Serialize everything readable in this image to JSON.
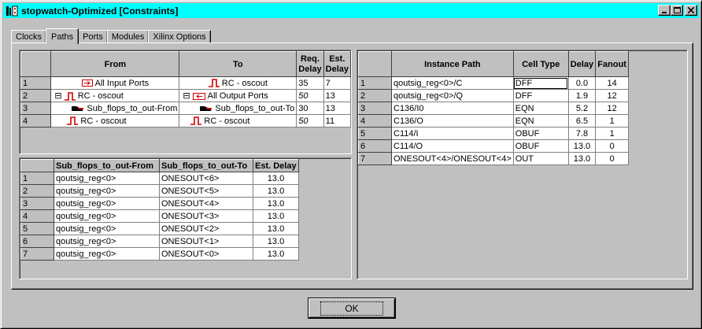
{
  "window": {
    "title": "stopwatch-Optimized [Constraints]",
    "titlebar_color": "#00ffff"
  },
  "tabs": [
    {
      "label": "Clocks",
      "active": false
    },
    {
      "label": "Paths",
      "active": true
    },
    {
      "label": "Ports",
      "active": false
    },
    {
      "label": "Modules",
      "active": false
    },
    {
      "label": "Xilinx Options",
      "active": false
    }
  ],
  "paths_table": {
    "headers": {
      "from": "From",
      "to": "To",
      "req_delay": "Req. Delay",
      "est_delay": "Est. Delay"
    },
    "rows": [
      {
        "num": "1",
        "from_icon": "input-port-icon",
        "from": "All Input Ports",
        "to_icon": "clock-icon",
        "to": "RC - oscout",
        "req": "35",
        "req_italic": false,
        "est": "7"
      },
      {
        "num": "2",
        "from_icon": "clock-icon",
        "from": "RC - oscout",
        "from_expand": "⊟",
        "to_icon": "output-port-icon",
        "to": "All Output Ports",
        "to_expand": "⊟",
        "req": "50",
        "req_italic": true,
        "est": "13"
      },
      {
        "num": "3",
        "from_icon": "subset-icon",
        "from": "Sub_flops_to_out-From",
        "to_icon": "subset-icon",
        "to": "Sub_flops_to_out-To",
        "req": "30",
        "req_italic": false,
        "est": "13"
      },
      {
        "num": "4",
        "from_icon": "clock-icon",
        "from": "RC - oscout",
        "to_icon": "clock-icon",
        "to": "RC - oscout",
        "req": "50",
        "req_italic": true,
        "est": "11"
      }
    ]
  },
  "subpaths_table": {
    "headers": {
      "from": "Sub_flops_to_out-From",
      "to": "Sub_flops_to_out-To",
      "est_delay": "Est. Delay"
    },
    "rows": [
      {
        "num": "1",
        "from": "qoutsig_reg<0>",
        "to": "ONESOUT<6>",
        "est": "13.0"
      },
      {
        "num": "2",
        "from": "qoutsig_reg<0>",
        "to": "ONESOUT<5>",
        "est": "13.0"
      },
      {
        "num": "3",
        "from": "qoutsig_reg<0>",
        "to": "ONESOUT<4>",
        "est": "13.0"
      },
      {
        "num": "4",
        "from": "qoutsig_reg<0>",
        "to": "ONESOUT<3>",
        "est": "13.0"
      },
      {
        "num": "5",
        "from": "qoutsig_reg<0>",
        "to": "ONESOUT<2>",
        "est": "13.0"
      },
      {
        "num": "6",
        "from": "qoutsig_reg<0>",
        "to": "ONESOUT<1>",
        "est": "13.0"
      },
      {
        "num": "7",
        "from": "qoutsig_reg<0>",
        "to": "ONESOUT<0>",
        "est": "13.0"
      }
    ]
  },
  "instance_table": {
    "headers": {
      "path": "Instance Path",
      "cell": "Cell Type",
      "delay": "Delay",
      "fanout": "Fanout"
    },
    "rows": [
      {
        "num": "1",
        "path": "qoutsig_reg<0>/C",
        "cell": "DFF",
        "delay": "0.0",
        "fanout": "14"
      },
      {
        "num": "2",
        "path": "qoutsig_reg<0>/Q",
        "cell": "DFF",
        "delay": "1.9",
        "fanout": "12"
      },
      {
        "num": "3",
        "path": "C136/I0",
        "cell": "EQN",
        "delay": "5.2",
        "fanout": "12"
      },
      {
        "num": "4",
        "path": "C136/O",
        "cell": "EQN",
        "delay": "6.5",
        "fanout": "1"
      },
      {
        "num": "5",
        "path": "C114/I",
        "cell": "OBUF",
        "delay": "7.8",
        "fanout": "1"
      },
      {
        "num": "6",
        "path": "C114/O",
        "cell": "OBUF",
        "delay": "13.0",
        "fanout": "0"
      },
      {
        "num": "7",
        "path": "ONESOUT<4>/ONESOUT<4>",
        "cell": "OUT",
        "delay": "13.0",
        "fanout": "0"
      }
    ]
  },
  "buttons": {
    "ok": "OK"
  }
}
